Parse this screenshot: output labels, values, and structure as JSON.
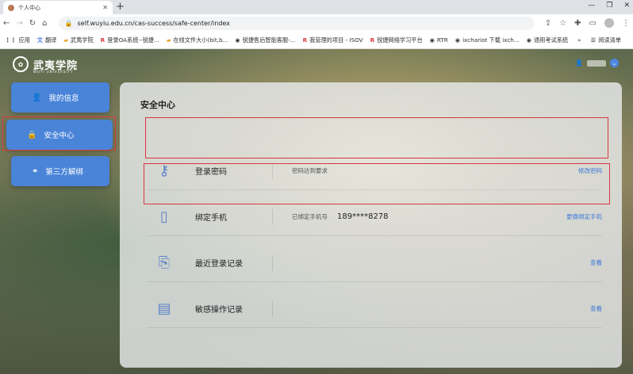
{
  "browser": {
    "tab_title": "个人中心",
    "url": "self.wuyiu.edu.cn/cas-success/safe-center/index"
  },
  "bookmarks": [
    {
      "icon": "apps-icon",
      "label": "应用"
    },
    {
      "icon": "translate-icon",
      "label": "翻译"
    },
    {
      "icon": "folder-icon",
      "label": "武夷学院"
    },
    {
      "icon": "r-icon",
      "label": "登录OA系统--锐捷..."
    },
    {
      "icon": "folder-icon",
      "label": "在线文件大小(bit,b..."
    },
    {
      "icon": "globe-icon",
      "label": "锐捷售后智能客服-..."
    },
    {
      "icon": "r-icon",
      "label": "我管理的项目 - ISOV"
    },
    {
      "icon": "r-icon",
      "label": "锐捷网络学习平台"
    },
    {
      "icon": "globe-icon",
      "label": "RTR"
    },
    {
      "icon": "globe-icon",
      "label": "ixchariot 下载 ixch..."
    },
    {
      "icon": "globe-icon",
      "label": "通用考试系统"
    },
    {
      "icon": "more-icon",
      "label": "»"
    },
    {
      "icon": "reading-list-icon",
      "label": "阅读清单"
    }
  ],
  "logo": {
    "name": "武夷学院",
    "en": "WUYI UNIVERSITY"
  },
  "sidebar": [
    {
      "label": "我的信息",
      "icon": "user-icon"
    },
    {
      "label": "安全中心",
      "icon": "lock-icon"
    },
    {
      "label": "第三方解绑",
      "icon": "link-icon"
    }
  ],
  "panel": {
    "title": "安全中心",
    "rows": [
      {
        "icon": "key-icon",
        "label": "登录密码",
        "desc": "密码达到要求",
        "value": "",
        "action": "修改密码"
      },
      {
        "icon": "phone-icon",
        "label": "绑定手机",
        "desc": "已绑定手机号",
        "value": "189****8278",
        "action": "更换绑定手机"
      },
      {
        "icon": "documents-icon",
        "label": "最近登录记录",
        "desc": "",
        "value": "",
        "action": "查看"
      },
      {
        "icon": "record-icon",
        "label": "敏感操作记录",
        "desc": "",
        "value": "",
        "action": "查看"
      }
    ]
  },
  "colors": {
    "accent": "#4a84d8",
    "highlight": "#d9373b",
    "link": "#3b78d8"
  }
}
